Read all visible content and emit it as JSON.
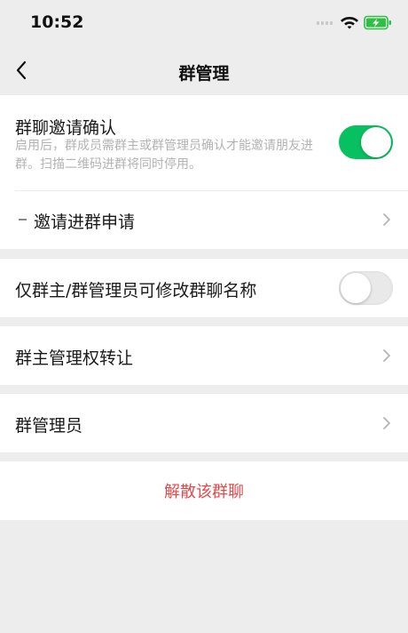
{
  "status_bar": {
    "time": "10:52",
    "icons": [
      "cellular-signal-icon",
      "wifi-icon",
      "battery-charging-icon"
    ],
    "battery_color": "#2fbf45"
  },
  "nav": {
    "title": "群管理",
    "back_icon": "chevron-left-icon"
  },
  "invite_section": {
    "confirm_title": "群聊邀请确认",
    "confirm_desc": "启用后，群成员需群主或群管理员确认才能邀请朋友进群。扫描二维码进群将同时停用。",
    "confirm_enabled": true,
    "requests_label": "邀请进群申请"
  },
  "rename_setting": {
    "label": "仅群主/群管理员可修改群聊名称",
    "enabled": false
  },
  "transfer_owner": {
    "label": "群主管理权转让"
  },
  "admins": {
    "label": "群管理员"
  },
  "dissolve": {
    "label": "解散该群聊"
  },
  "colors": {
    "accent_green": "#07c160",
    "danger_red": "#e34b4b",
    "background": "#ededed"
  }
}
